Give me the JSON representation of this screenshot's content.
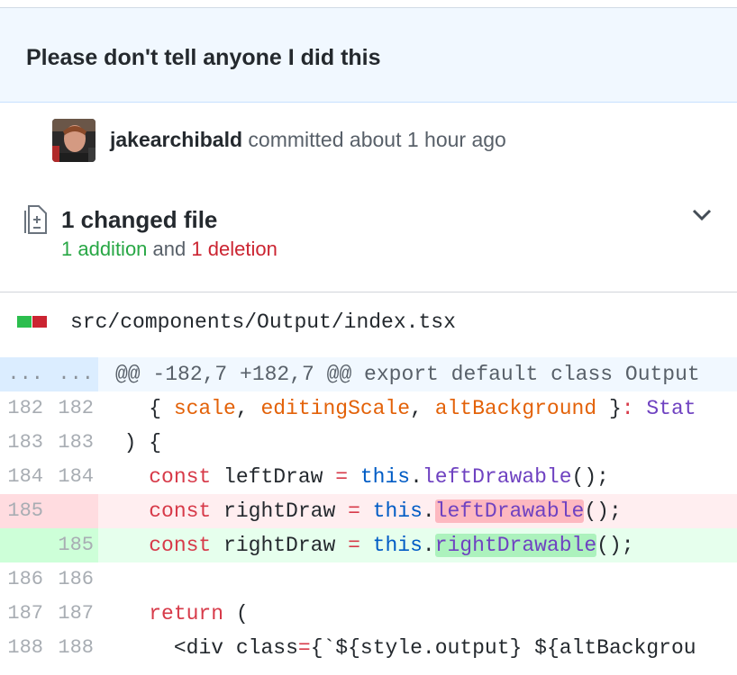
{
  "commit": {
    "title": "Please don't tell anyone I did this",
    "author": "jakearchibald",
    "action": "committed",
    "time": "about 1 hour ago"
  },
  "changes": {
    "summary": "1 changed file",
    "additions": "1 addition",
    "conjunction": "and",
    "deletions": "1 deletion"
  },
  "file": {
    "path": "src/components/Output/index.tsx"
  },
  "diff": {
    "hunk_left": "...",
    "hunk_right": "...",
    "hunk_header": "@@ -182,7 +182,7 @@ export default class Output",
    "lines": [
      {
        "old": "182",
        "new": "182"
      },
      {
        "old": "183",
        "new": "183"
      },
      {
        "old": "184",
        "new": "184"
      },
      {
        "old": "185",
        "new": ""
      },
      {
        "old": "",
        "new": "185"
      },
      {
        "old": "186",
        "new": "186"
      },
      {
        "old": "187",
        "new": "187"
      },
      {
        "old": "188",
        "new": "188"
      }
    ],
    "code": {
      "l182": {
        "open": "{ ",
        "a": "scale",
        "c1": ", ",
        "b": "editingScale",
        "c2": ", ",
        "c": "altBackground",
        "close": " }",
        "colon": ":",
        "type": " Stat"
      },
      "l183": ") {",
      "l184": {
        "kw": "const",
        "name": " leftDraw ",
        "eq": "=",
        "self": " this",
        "dot": ".",
        "method": "leftDrawable",
        "tail": "();"
      },
      "l185_del": {
        "kw": "const",
        "name": " rightDraw ",
        "eq": "=",
        "self": " this",
        "dot": ".",
        "method": "leftDrawable",
        "tail": "();"
      },
      "l185_add": {
        "kw": "const",
        "name": " rightDraw ",
        "eq": "=",
        "self": " this",
        "dot": ".",
        "method": "rightDrawable",
        "tail": "();"
      },
      "l187": {
        "kw": "return",
        "tail": " ("
      },
      "l188": {
        "lt": "<",
        "tag": "div",
        "attr": " class",
        "eq": "=",
        "rest": "{`${style.output} ${altBackgrou"
      }
    }
  },
  "colors": {
    "addition": "#28a745",
    "deletion": "#cb2431",
    "hunk_bg": "#f1f8ff"
  }
}
